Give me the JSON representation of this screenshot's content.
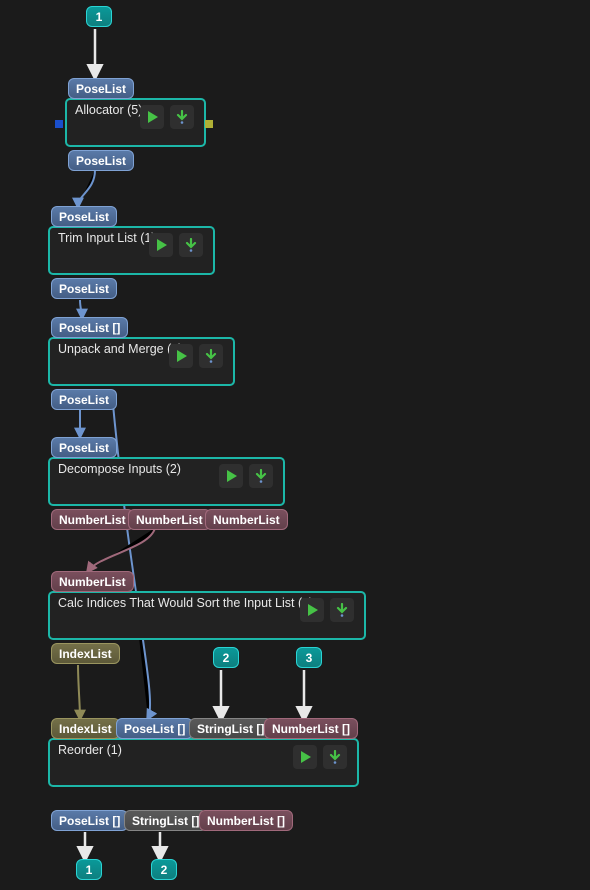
{
  "inputs": {
    "one": "1",
    "two": "2",
    "three": "3"
  },
  "outputs": {
    "one": "1",
    "two": "2"
  },
  "types": {
    "poselist": "PoseList",
    "poselist_arr": "PoseList []",
    "numberlist": "NumberList",
    "numberlist_arr": "NumberList []",
    "indexlist": "IndexList",
    "stringlist_arr": "StringList []"
  },
  "nodes": {
    "allocator": {
      "title": "Allocator (5)"
    },
    "trim": {
      "title": "Trim Input List (1)"
    },
    "unpack": {
      "title": "Unpack and Merge (1)"
    },
    "decompose": {
      "title": "Decompose Inputs (2)"
    },
    "calc": {
      "title": "Calc Indices That Would Sort the Input List (1)"
    },
    "reorder": {
      "title": "Reorder (1)"
    }
  }
}
